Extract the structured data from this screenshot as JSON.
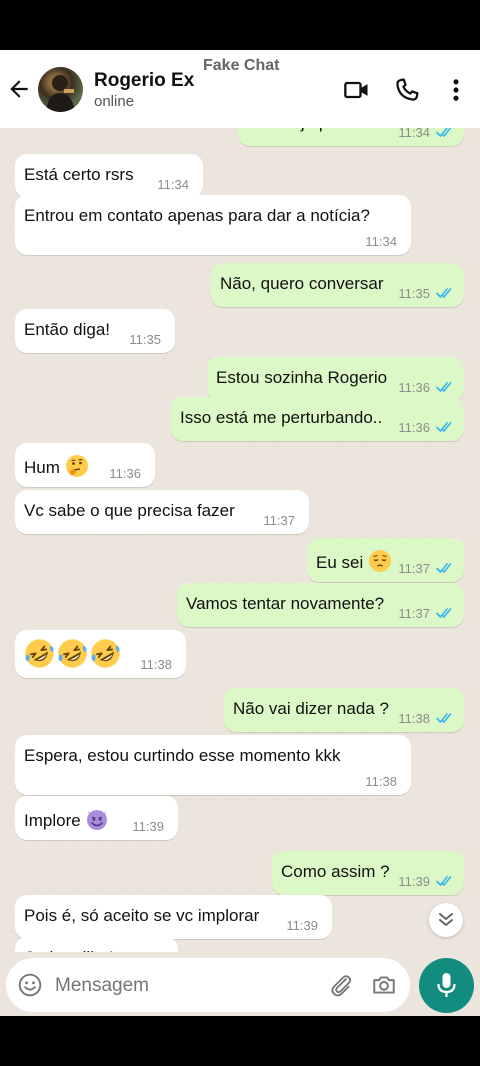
{
  "header": {
    "contact_name": "Rogerio Ex",
    "contact_status": "online",
    "watermark": "Fake Chat"
  },
  "messages": [
    {
      "dir": "out",
      "text": "Não finja por favor",
      "time": "11:34",
      "emoji": []
    },
    {
      "dir": "in",
      "text": "Está certo rsrs",
      "time": "11:34",
      "emoji": []
    },
    {
      "dir": "in",
      "text": "Entrou em contato apenas para dar a notícia?",
      "time": "11:34",
      "emoji": []
    },
    {
      "dir": "out",
      "text": "Não, quero conversar",
      "time": "11:35",
      "emoji": []
    },
    {
      "dir": "in",
      "text": "Então diga!",
      "time": "11:35",
      "emoji": []
    },
    {
      "dir": "out",
      "text": "Estou sozinha Rogerio",
      "time": "11:36",
      "emoji": []
    },
    {
      "dir": "out",
      "text": "Isso está me perturbando..",
      "time": "11:36",
      "emoji": []
    },
    {
      "dir": "in",
      "text": "Hum",
      "time": "11:36",
      "emoji": [
        "thinking"
      ]
    },
    {
      "dir": "in",
      "text": "Vc sabe o que precisa fazer",
      "time": "11:37",
      "emoji": []
    },
    {
      "dir": "out",
      "text": "Eu sei",
      "time": "11:37",
      "emoji": [
        "pensive"
      ]
    },
    {
      "dir": "out",
      "text": "Vamos tentar novamente?",
      "time": "11:37",
      "emoji": []
    },
    {
      "dir": "in",
      "text": "",
      "time": "11:38",
      "emoji": [
        "rofl",
        "rofl",
        "rofl"
      ]
    },
    {
      "dir": "out",
      "text": "Não vai dizer nada ?",
      "time": "11:38",
      "emoji": []
    },
    {
      "dir": "in",
      "text": "Espera, estou curtindo esse momento kkk",
      "time": "11:38",
      "emoji": []
    },
    {
      "dir": "in",
      "text": "Implore",
      "time": "11:39",
      "emoji": [
        "smiling-devil"
      ]
    },
    {
      "dir": "out",
      "text": "Como assim ?",
      "time": "11:39",
      "emoji": []
    },
    {
      "dir": "in",
      "text": "Pois é, só aceito se vc implorar",
      "time": "11:39",
      "emoji": []
    },
    {
      "dir": "in",
      "text": "Se humilha!",
      "time": "",
      "emoji": []
    }
  ],
  "composer": {
    "placeholder": "Mensagem"
  },
  "icons": {
    "back": "arrow-left-icon",
    "video": "video-call-icon",
    "call": "phone-icon",
    "menu": "more-vert-icon",
    "emoji": "emoji-icon",
    "attach": "paperclip-icon",
    "camera": "camera-icon",
    "mic": "mic-icon",
    "scroll": "double-chevron-down-icon"
  },
  "colors": {
    "incoming_bubble": "#ffffff",
    "outgoing_bubble": "#dcf8c6",
    "chat_background": "#ece5dd",
    "read_ticks": "#34b7f1",
    "mic_button": "#128c7e"
  }
}
